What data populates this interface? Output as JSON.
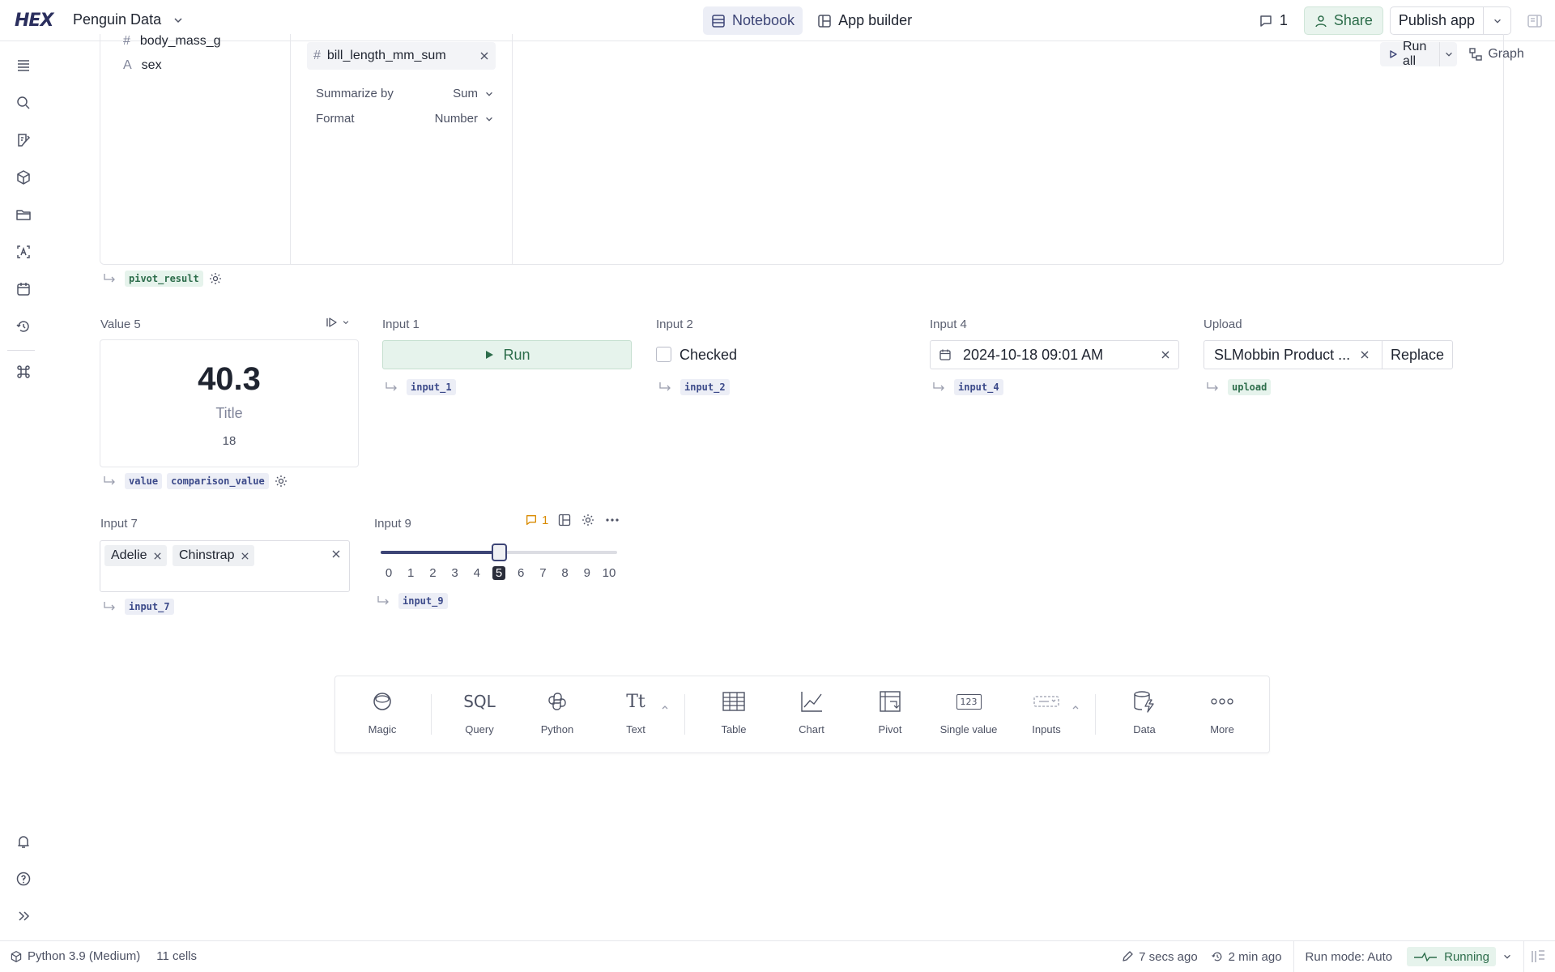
{
  "header": {
    "logo": "HEX",
    "project_name": "Penguin Data",
    "tabs": [
      {
        "label": "Notebook",
        "active": true
      },
      {
        "label": "App builder",
        "active": false
      }
    ],
    "comment_count": "1",
    "share_label": "Share",
    "publish_label": "Publish app"
  },
  "sidebar": {
    "items": [
      "outline-icon",
      "search-icon",
      "variables-icon",
      "components-icon",
      "files-icon",
      "data-browser-icon",
      "schedule-icon",
      "history-icon",
      "command-icon"
    ],
    "bottom_items": [
      "notifications-icon",
      "help-icon",
      "expand-icon"
    ]
  },
  "pivot_cell": {
    "fields": [
      {
        "type": "#",
        "name": "body_mass_g"
      },
      {
        "type": "A",
        "name": "sex"
      }
    ],
    "value_field": "bill_length_mm_sum",
    "summarize_by_label": "Summarize by",
    "summarize_by_value": "Sum",
    "format_label": "Format",
    "format_value": "Number",
    "run_all_label": "Run all",
    "graph_label": "Graph",
    "output_var": "pivot_result"
  },
  "single_value_cell": {
    "label": "Value 5",
    "value": "40.3",
    "title": "Title",
    "comparison": "18",
    "output_vars": [
      "value",
      "comparison_value"
    ]
  },
  "input1": {
    "label": "Input 1",
    "button_label": "Run",
    "var": "input_1"
  },
  "input2": {
    "label": "Input 2",
    "checkbox_label": "Checked",
    "checked": false,
    "var": "input_2"
  },
  "input4": {
    "label": "Input 4",
    "value": "2024-10-18 09:01 AM",
    "var": "input_4"
  },
  "upload": {
    "label": "Upload",
    "file_name": "SLMobbin Product ...",
    "replace_label": "Replace",
    "var": "upload"
  },
  "input7": {
    "label": "Input 7",
    "selected": [
      "Adelie",
      "Chinstrap"
    ],
    "var": "input_7"
  },
  "input9": {
    "label": "Input 9",
    "comment_count": "1",
    "min": 0,
    "max": 10,
    "value": 5,
    "ticks": [
      "0",
      "1",
      "2",
      "3",
      "4",
      "5",
      "6",
      "7",
      "8",
      "9",
      "10"
    ],
    "var": "input_9"
  },
  "add_cell_bar": {
    "items": [
      {
        "label": "Magic",
        "icon": "magic-icon"
      },
      {
        "label": "Query",
        "icon": "sql-icon",
        "glyph": "SQL"
      },
      {
        "label": "Python",
        "icon": "python-icon"
      },
      {
        "label": "Text",
        "icon": "text-icon",
        "glyph": "Tt"
      },
      {
        "label": "Table",
        "icon": "table-icon"
      },
      {
        "label": "Chart",
        "icon": "chart-icon"
      },
      {
        "label": "Pivot",
        "icon": "pivot-icon"
      },
      {
        "label": "Single value",
        "icon": "single-value-icon",
        "glyph": "123"
      },
      {
        "label": "Inputs",
        "icon": "inputs-icon"
      },
      {
        "label": "Data",
        "icon": "data-icon"
      },
      {
        "label": "More",
        "icon": "more-icon"
      }
    ]
  },
  "status_bar": {
    "kernel": "Python 3.9 (Medium)",
    "cells": "11 cells",
    "saved": "7 secs ago",
    "run_time": "2 min ago",
    "run_mode": "Run mode: Auto",
    "running": "Running"
  },
  "colors": {
    "accent": "#3d4576",
    "green": "#2d6d4b",
    "comment": "#d98a00"
  }
}
